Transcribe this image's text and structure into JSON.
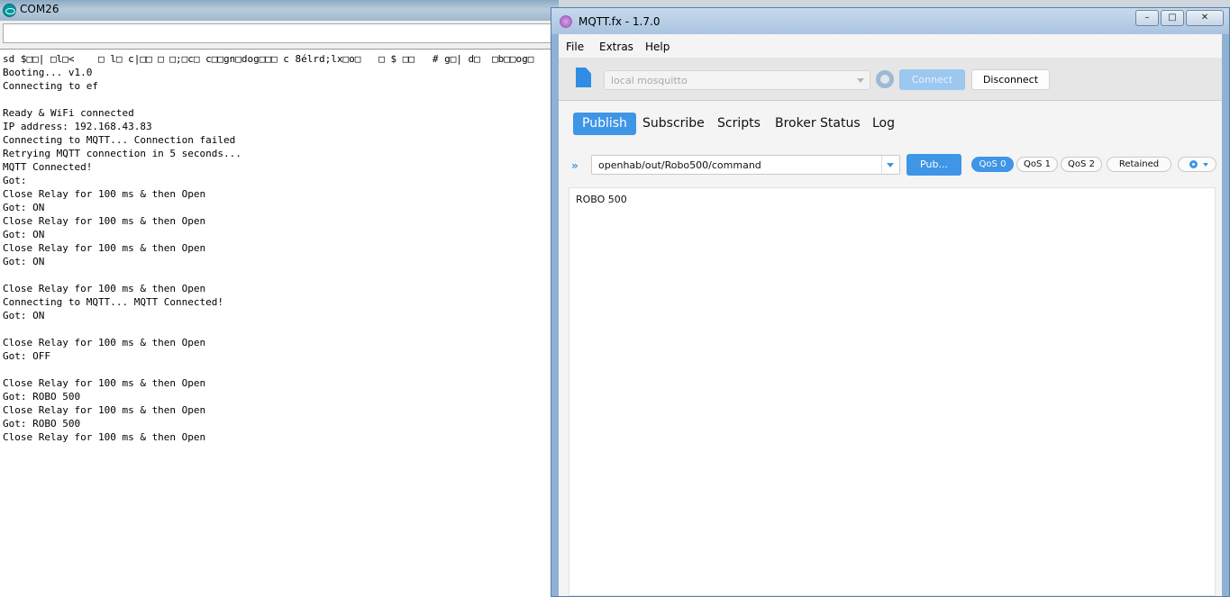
{
  "serial": {
    "title": "COM26",
    "input_value": "",
    "lines": [
      "sd $□□| □l□<    □ l□ c|□□ □ □;□c□ c□□gn□dog□□□ c 8élrd;lx□o□   □ $ □□   # g□| d□  □b□□og□",
      "Booting... v1.0",
      "Connecting to ef",
      "",
      "Ready & WiFi connected",
      "IP address: 192.168.43.83",
      "Connecting to MQTT... Connection failed",
      "Retrying MQTT connection in 5 seconds...",
      "MQTT Connected!",
      "Got:",
      "Close Relay for 100 ms & then Open",
      "Got: ON",
      "Close Relay for 100 ms & then Open",
      "Got: ON",
      "Close Relay for 100 ms & then Open",
      "Got: ON",
      "",
      "Close Relay for 100 ms & then Open",
      "Connecting to MQTT... MQTT Connected!",
      "Got: ON",
      "",
      "Close Relay for 100 ms & then Open",
      "Got: OFF",
      "",
      "Close Relay for 100 ms & then Open",
      "Got: ROBO 500",
      "Close Relay for 100 ms & then Open",
      "Got: ROBO 500",
      "Close Relay for 100 ms & then Open"
    ]
  },
  "mqtt": {
    "title": "MQTT.fx - 1.7.0",
    "window_buttons": {
      "minimize": "–",
      "maximize": "□",
      "close": "✕"
    },
    "menu": {
      "file": "File",
      "extras": "Extras",
      "help": "Help"
    },
    "connection": {
      "profile": "local mosquitto",
      "connect_label": "Connect",
      "disconnect_label": "Disconnect"
    },
    "tabs": {
      "publish": "Publish",
      "subscribe": "Subscribe",
      "scripts": "Scripts",
      "broker_status": "Broker Status",
      "log": "Log"
    },
    "publish": {
      "chevron": "»",
      "topic": "openhab/out/Robo500/command",
      "publish_label": "Pub...",
      "qos0": "QoS 0",
      "qos1": "QoS 1",
      "qos2": "QoS 2",
      "retained": "Retained",
      "payload": "ROBO 500"
    },
    "colors": {
      "accent": "#3f95e6"
    }
  }
}
